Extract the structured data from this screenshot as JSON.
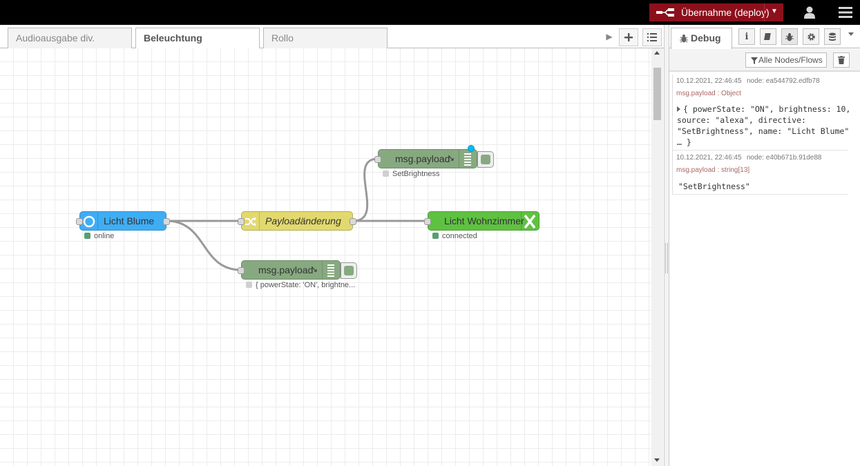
{
  "header": {
    "deploy_label": "Übernahme (deploy)"
  },
  "tabs": [
    {
      "label": "Audioausgabe div."
    },
    {
      "label": "Beleuchtung"
    },
    {
      "label": "Rollo"
    }
  ],
  "nodes": {
    "licht_blume": {
      "label": "Licht Blume",
      "status": "online"
    },
    "payloadaenderung": {
      "label": "Payloadänderung"
    },
    "licht_wohnzimmer": {
      "label": "Licht Wohnzimmer",
      "status": "connected"
    },
    "debug_top": {
      "label": "msg.payload",
      "status": "SetBrightness"
    },
    "debug_bottom": {
      "label": "msg.payload",
      "status": "{ powerState: 'ON', brightne..."
    }
  },
  "sidebar": {
    "debug_tab_label": "Debug",
    "filter_label": "Alle Nodes/Flows",
    "messages": [
      {
        "timestamp": "10.12.2021, 22:46:45",
        "node": "node: ea544792.edfb78",
        "topic": "msg.payload : Object",
        "lines": [
          "{ powerState: \"ON\", brightness: 10,",
          "source: \"alexa\", directive:",
          "\"SetBrightness\", name: \"Licht Blume\"",
          "… }"
        ]
      },
      {
        "timestamp": "10.12.2021, 22:46:45",
        "node": "node: e40b671b.91de88",
        "topic": "msg.payload : string[13]",
        "value": "\"SetBrightness\""
      }
    ]
  },
  "colors": {
    "header_bg": "#000000",
    "deploy_bg": "#8c101c",
    "node_input_blue": "#3fadf4",
    "node_change_yellow": "#e2d96e",
    "node_debug_green": "#87a980",
    "node_output_green": "#5fc142"
  }
}
